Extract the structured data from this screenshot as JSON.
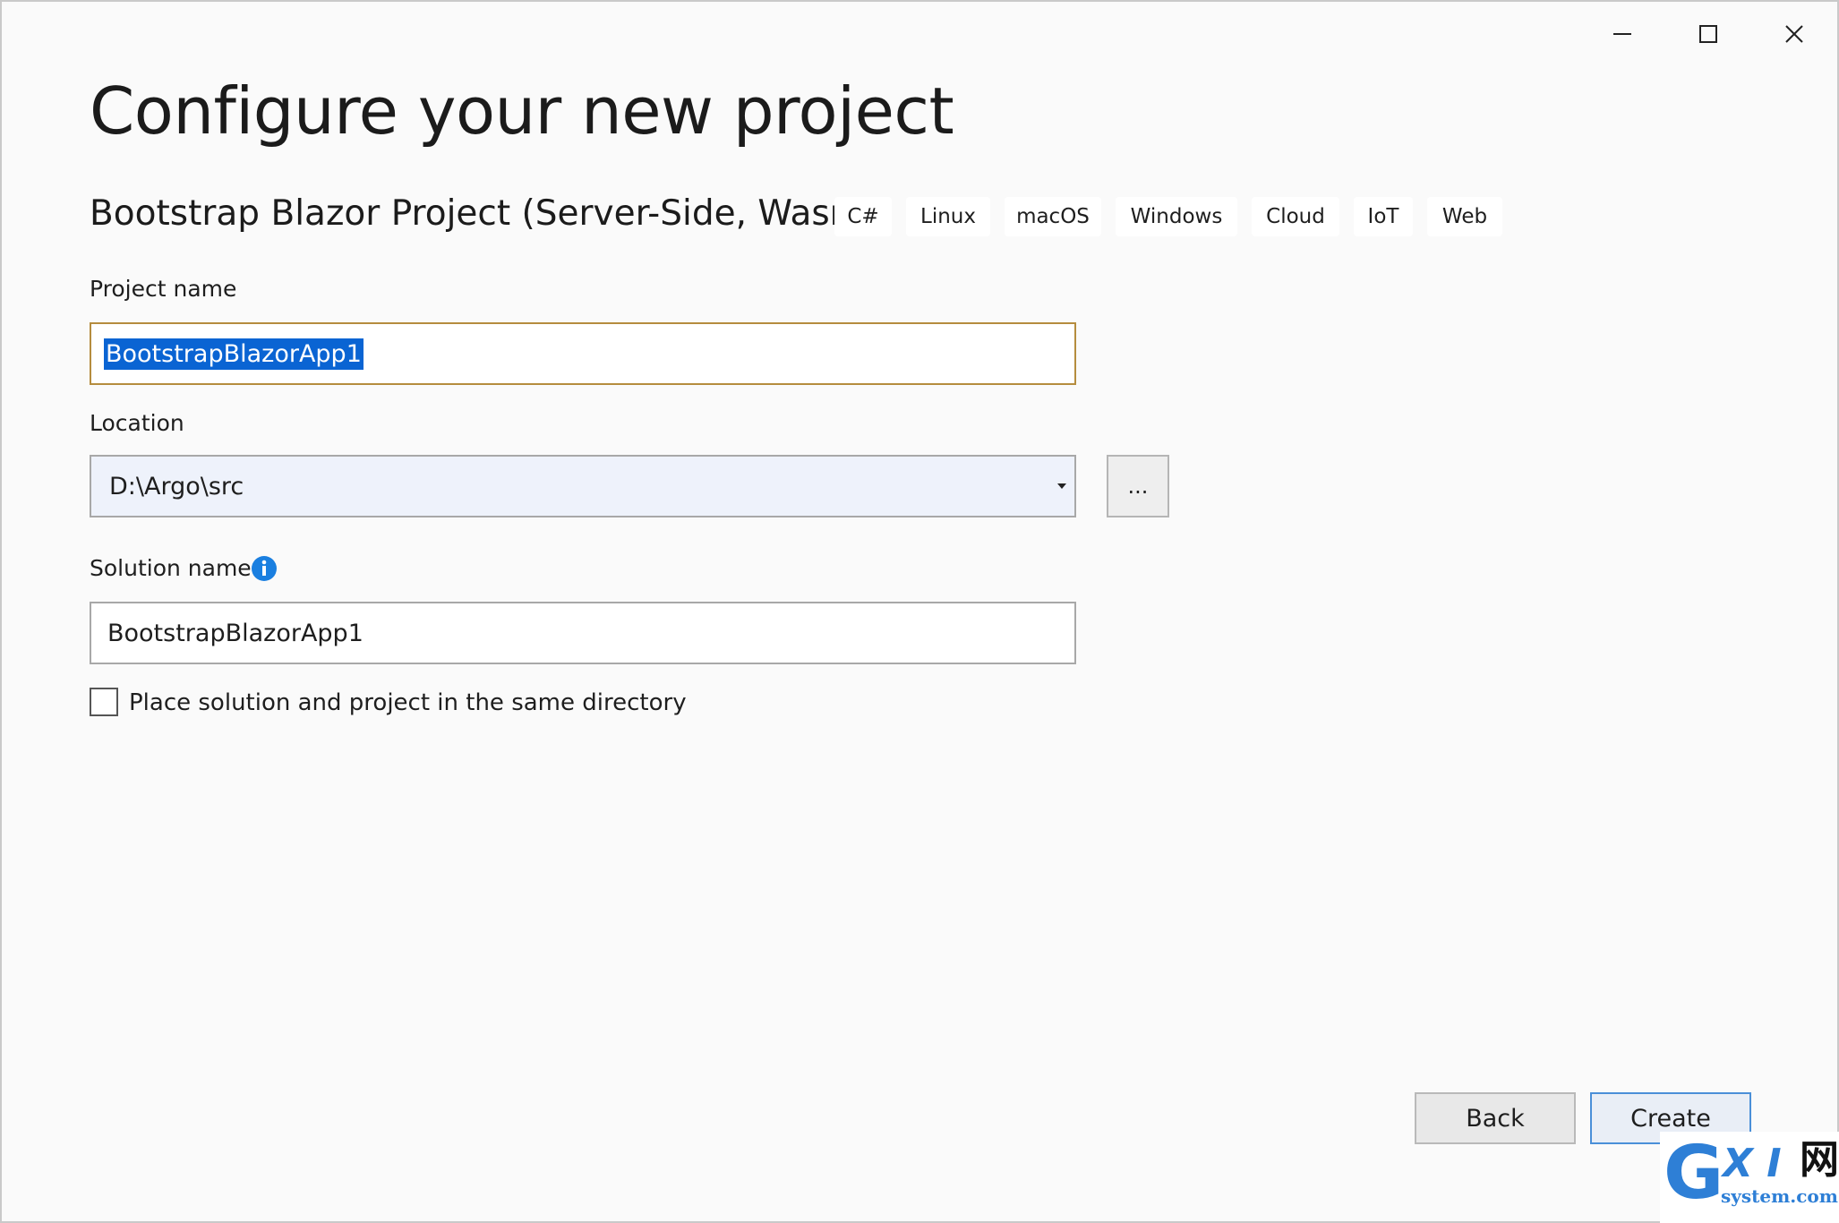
{
  "window": {
    "controls": {
      "minimize_icon": "minimize-icon",
      "maximize_icon": "maximize-icon",
      "close_icon": "close-icon"
    }
  },
  "page": {
    "title": "Configure your new project",
    "template_name": "Bootstrap Blazor Project (Server-Side, Wasm)",
    "tags": [
      "C#",
      "Linux",
      "macOS",
      "Windows",
      "Cloud",
      "IoT",
      "Web"
    ]
  },
  "form": {
    "project_name": {
      "label": "Project name",
      "value": "BootstrapBlazorApp1"
    },
    "location": {
      "label": "Location",
      "value": "D:\\Argo\\src",
      "browse_label": "..."
    },
    "solution_name": {
      "label": "Solution name",
      "value": "BootstrapBlazorApp1"
    },
    "same_directory": {
      "label": "Place solution and project in the same directory",
      "checked": false
    }
  },
  "footer": {
    "back_label": "Back",
    "create_label": "Create"
  },
  "watermark": {
    "g": "G",
    "xi": "X I",
    "wang": "网",
    "domain": "system.com"
  },
  "colors": {
    "accent": "#0a64d3",
    "focus_border": "#b58c3e",
    "create_border": "#4a8fd8",
    "info_icon": "#1a7fe0"
  }
}
